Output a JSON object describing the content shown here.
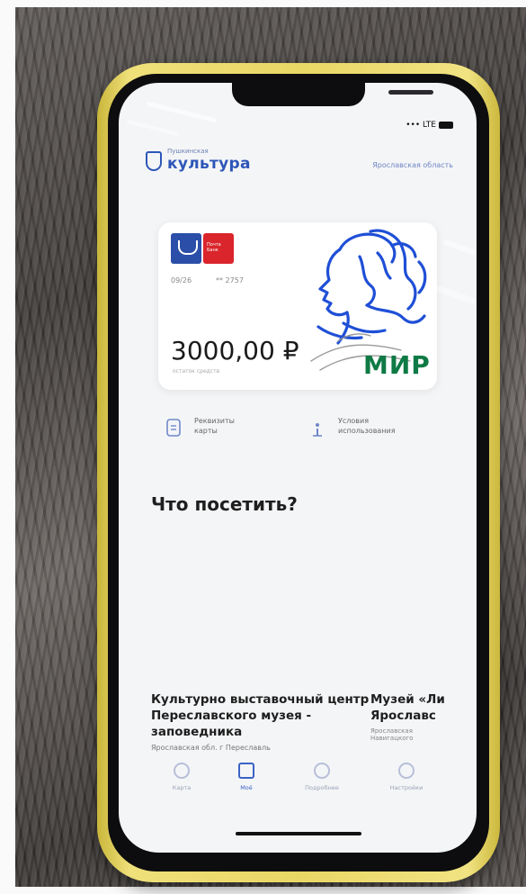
{
  "app": {
    "brand_small": "Пушкинская",
    "brand_name": "культура",
    "region": "Ярославская область"
  },
  "status": {
    "signal": "••• LTE"
  },
  "card": {
    "date": "09/26",
    "number": "** 2757",
    "bank_label": "Почта Банк",
    "balance": "3000,00 ₽",
    "balance_caption": "остаток средств",
    "payment_system": "МИР"
  },
  "actions": [
    {
      "label": "Реквизиты\nкарты"
    },
    {
      "label": "Условия\nиспользования"
    }
  ],
  "section_title": "Что посетить?",
  "places": [
    {
      "title": "Культурно выставочный центр Переславского музея - заповедника",
      "subtitle": "Ярославская обл. г Переславль"
    },
    {
      "title": "Музей «Ли\nЯрославс",
      "subtitle": "Ярославская\nНавигацкого"
    }
  ],
  "tabs": [
    {
      "label": "Карта"
    },
    {
      "label": "Моё"
    },
    {
      "label": "Подробнее"
    },
    {
      "label": "Настройки"
    }
  ],
  "colors": {
    "accent": "#3a63c4",
    "mir_green": "#0f7a45",
    "case_yellow": "#e9d765"
  }
}
